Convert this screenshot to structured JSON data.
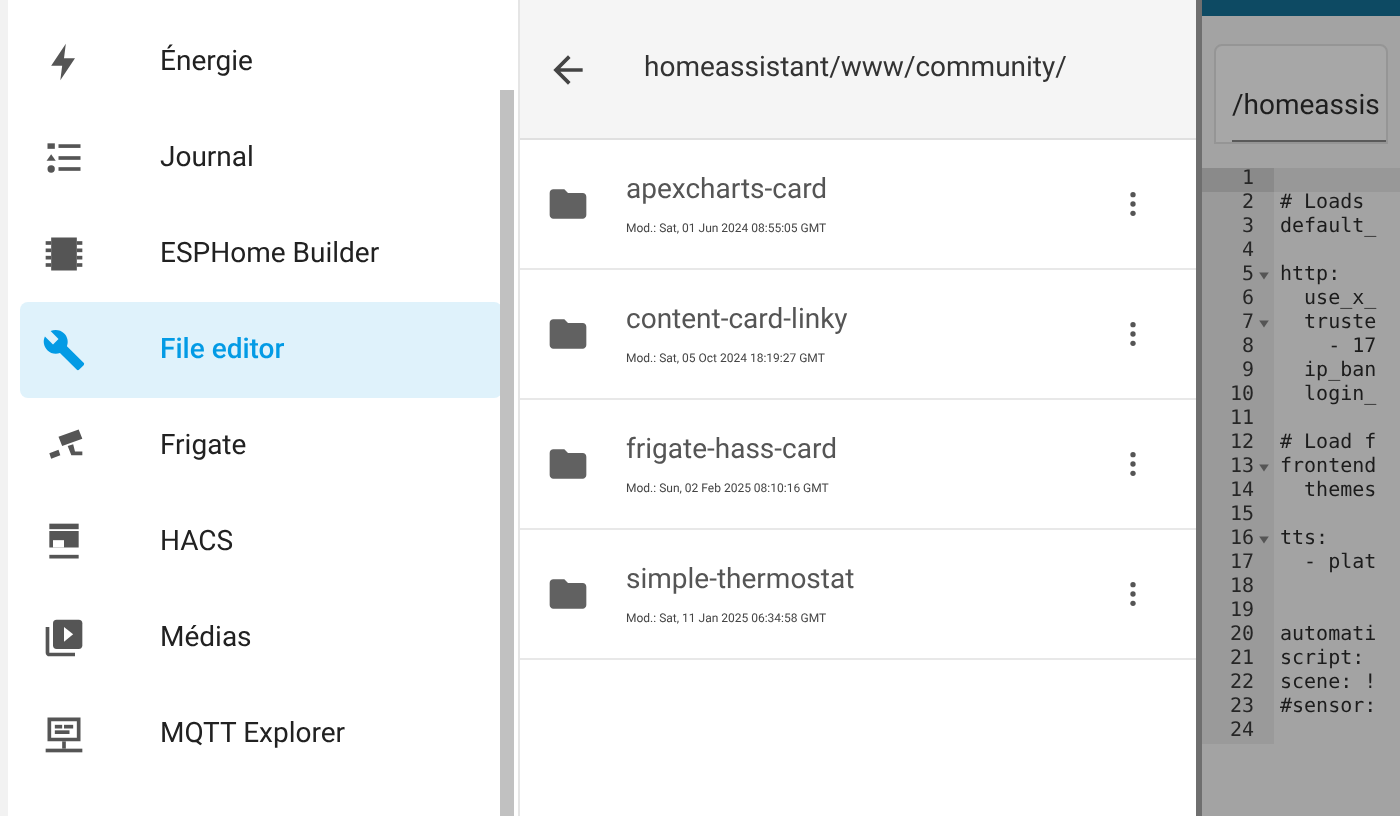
{
  "sidebar": {
    "items": [
      {
        "label": "Énergie",
        "selected": false
      },
      {
        "label": "Journal",
        "selected": false
      },
      {
        "label": "ESPHome Builder",
        "selected": false
      },
      {
        "label": "File editor",
        "selected": true
      },
      {
        "label": "Frigate",
        "selected": false
      },
      {
        "label": "HACS",
        "selected": false
      },
      {
        "label": "Médias",
        "selected": false
      },
      {
        "label": "MQTT Explorer",
        "selected": false
      }
    ]
  },
  "browser": {
    "path": "homeassistant/www/community/",
    "entries": [
      {
        "name": "apexcharts-card",
        "modified": "Mod.: Sat, 01 Jun 2024 08:55:05 GMT"
      },
      {
        "name": "content-card-linky",
        "modified": "Mod.: Sat, 05 Oct 2024 18:19:27 GMT"
      },
      {
        "name": "frigate-hass-card",
        "modified": "Mod.: Sun, 02 Feb 2025 08:10:16 GMT"
      },
      {
        "name": "simple-thermostat",
        "modified": "Mod.: Sat, 11 Jan 2025 06:34:58 GMT"
      }
    ]
  },
  "editor": {
    "file_path": "/homeassis",
    "lines": [
      {
        "number": "1",
        "fold": false,
        "active": true
      },
      {
        "number": "2",
        "text": "# Loads",
        "fold": false,
        "active": false
      },
      {
        "number": "3",
        "text": "default_",
        "fold": false,
        "active": false
      },
      {
        "number": "4",
        "fold": false,
        "active": false
      },
      {
        "number": "5",
        "text": "http:",
        "fold": true,
        "active": false
      },
      {
        "number": "6",
        "text": "  use_x_",
        "fold": false,
        "active": false
      },
      {
        "number": "7",
        "text": "  truste",
        "fold": true,
        "active": false
      },
      {
        "number": "8",
        "text": "    - 17",
        "fold": false,
        "active": false
      },
      {
        "number": "9",
        "text": "  ip_ban",
        "fold": false,
        "active": false
      },
      {
        "number": "10",
        "text": "  login_",
        "fold": false,
        "active": false
      },
      {
        "number": "11",
        "fold": false,
        "active": false
      },
      {
        "number": "12",
        "text": "# Load f",
        "fold": false,
        "active": false
      },
      {
        "number": "13",
        "text": "frontend",
        "fold": true,
        "active": false
      },
      {
        "number": "14",
        "text": "  themes",
        "fold": false,
        "active": false
      },
      {
        "number": "15",
        "fold": false,
        "active": false
      },
      {
        "number": "16",
        "text": "tts:",
        "fold": true,
        "active": false
      },
      {
        "number": "17",
        "text": "  - plat",
        "fold": false,
        "active": false
      },
      {
        "number": "18",
        "fold": false,
        "active": false
      },
      {
        "number": "19",
        "fold": false,
        "active": false
      },
      {
        "number": "20",
        "text": "automati",
        "fold": false,
        "active": false
      },
      {
        "number": "21",
        "text": "script:",
        "fold": false,
        "active": false
      },
      {
        "number": "22",
        "text": "scene: !",
        "fold": false,
        "active": false
      },
      {
        "number": "23",
        "text": "#sensor:",
        "fold": false,
        "active": false
      },
      {
        "number": "24",
        "fold": false,
        "active": false
      }
    ]
  }
}
